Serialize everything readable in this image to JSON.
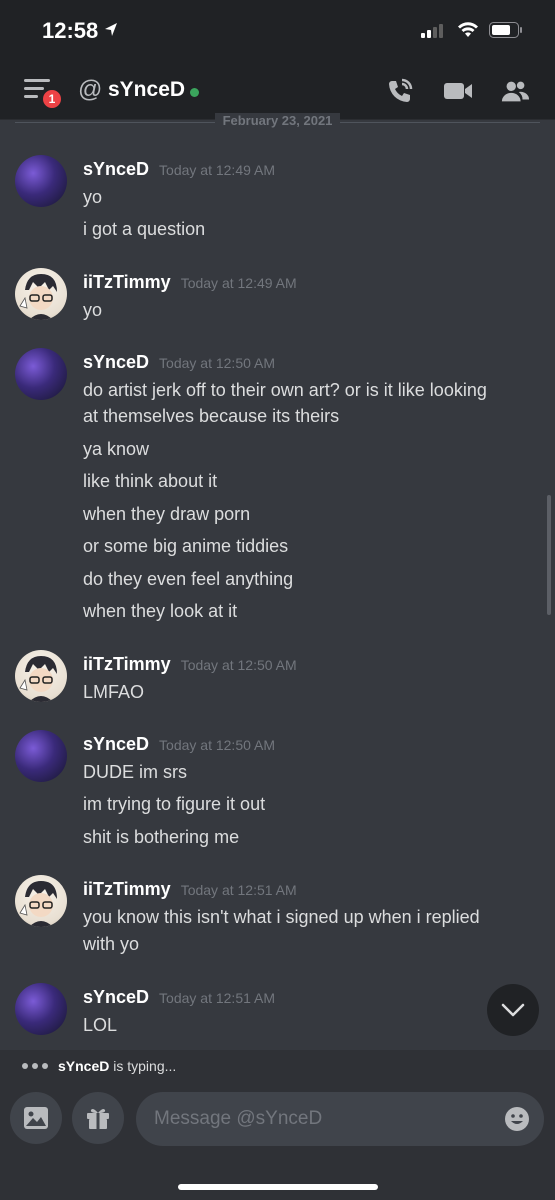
{
  "status_bar": {
    "time": "12:58"
  },
  "header": {
    "badge_count": "1",
    "title": "sYnceD"
  },
  "date_divider": "February 23, 2021",
  "messages": [
    {
      "author": "sYnceD",
      "time": "Today at 12:49 AM",
      "lines": [
        "yo",
        "i got a question"
      ]
    },
    {
      "author": "iiTzTimmy",
      "time": "Today at 12:49 AM",
      "lines": [
        "yo"
      ]
    },
    {
      "author": "sYnceD",
      "time": "Today at 12:50 AM",
      "lines": [
        "do artist jerk off to their own art? or is it like looking",
        "at themselves because its theirs",
        "ya know",
        "like think about it",
        "when they draw porn",
        "or some big anime tiddies",
        "do they even feel anything",
        "when they look at it"
      ]
    },
    {
      "author": "iiTzTimmy",
      "time": "Today at 12:50 AM",
      "lines": [
        "LMFAO"
      ]
    },
    {
      "author": "sYnceD",
      "time": "Today at 12:50 AM",
      "lines": [
        "DUDE im srs",
        "im trying to figure it out",
        "shit is bothering me"
      ]
    },
    {
      "author": "iiTzTimmy",
      "time": "Today at 12:51 AM",
      "lines": [
        "you know this isn't what i signed up when i replied",
        "with yo"
      ]
    },
    {
      "author": "sYnceD",
      "time": "Today at 12:51 AM",
      "lines": [
        "LOL"
      ]
    }
  ],
  "typing": {
    "user": "sYnceD",
    "text": "is typing..."
  },
  "composer": {
    "placeholder": "Message @sYnceD"
  },
  "colors": {
    "background": "#36393f",
    "header": "#202225",
    "online": "#3ba55d",
    "badge": "#ed4245"
  }
}
